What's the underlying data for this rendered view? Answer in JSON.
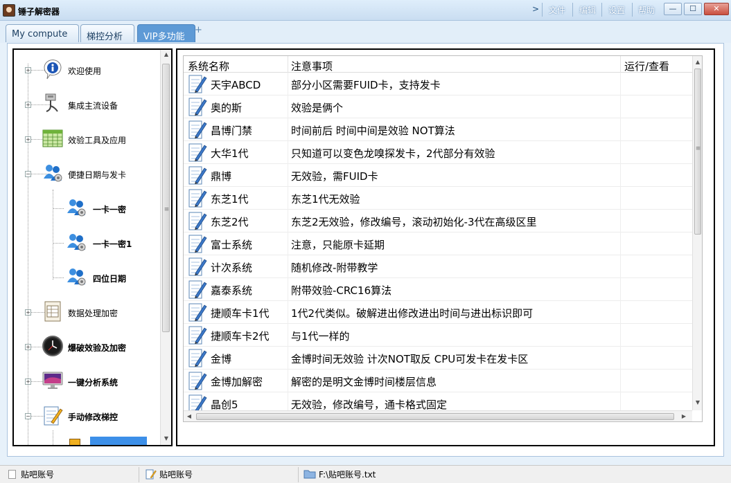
{
  "window": {
    "title": "锤子解密器",
    "menu": [
      "文件",
      "编辑",
      "设置",
      "帮助"
    ],
    "controls": {
      "minimize": "—",
      "maximize": "☐",
      "close": "✕"
    },
    "chevron": ">"
  },
  "tabs": [
    {
      "label": "My compute",
      "active": false
    },
    {
      "label": "梯控分析",
      "active": false
    },
    {
      "label": "VIP多功能",
      "active": true
    }
  ],
  "tab_add": "+",
  "tree": [
    {
      "label": "欢迎使用",
      "icon": "info-icon",
      "level": 0,
      "expander": "+",
      "bold": false
    },
    {
      "label": "集成主流设备",
      "icon": "cable-icon",
      "level": 0,
      "expander": "+",
      "bold": false
    },
    {
      "label": "效验工具及应用",
      "icon": "spreadsheet-icon",
      "level": 0,
      "expander": "+",
      "bold": false
    },
    {
      "label": "便捷日期与发卡",
      "icon": "users-gear-icon",
      "level": 0,
      "expander": "−",
      "bold": false
    },
    {
      "label": "一卡一密",
      "icon": "users-gear-icon",
      "level": 1,
      "expander": "",
      "bold": true
    },
    {
      "label": "一卡一密1",
      "icon": "users-gear-icon",
      "level": 1,
      "expander": "",
      "bold": true
    },
    {
      "label": "四位日期",
      "icon": "users-gear-icon",
      "level": 1,
      "expander": "",
      "bold": true
    },
    {
      "label": "数据处理加密",
      "icon": "document-table-icon",
      "level": 0,
      "expander": "+",
      "bold": false
    },
    {
      "label": "爆破效验及加密",
      "icon": "clock-icon",
      "level": 0,
      "expander": "+",
      "bold": true
    },
    {
      "label": "一键分析系统",
      "icon": "monitor-icon",
      "level": 0,
      "expander": "+",
      "bold": true
    },
    {
      "label": "手动修改梯控",
      "icon": "notepad-pencil-icon",
      "level": 0,
      "expander": "−",
      "bold": true
    }
  ],
  "list": {
    "columns": [
      "系统名称",
      "注意事项",
      "运行/查看"
    ],
    "rows": [
      {
        "name": "天宇ABCD",
        "note": "部分小区需要FUID卡，支持发卡"
      },
      {
        "name": "奥的斯",
        "note": "效验是俩个"
      },
      {
        "name": "昌博门禁",
        "note": "时间前后 时间中间是效验 NOT算法"
      },
      {
        "name": "大华1代",
        "note": "只知道可以变色龙嗅探发卡，2代部分有效验"
      },
      {
        "name": "鼎博",
        "note": "无效验，需FUID卡"
      },
      {
        "name": "东芝1代",
        "note": "东芝1代无效验"
      },
      {
        "name": "东芝2代",
        "note": "东芝2无效验，修改编号，滚动初始化-3代在高级区里"
      },
      {
        "name": "富士系统",
        "note": "注意，只能原卡延期"
      },
      {
        "name": "计次系统",
        "note": "随机修改-附带教学"
      },
      {
        "name": "嘉泰系统",
        "note": "附带效验-CRC16算法"
      },
      {
        "name": "捷顺车卡1代",
        "note": "1代2代类似。破解进出修改进出时间与进出标识即可"
      },
      {
        "name": "捷顺车卡2代",
        "note": "与1代一样的"
      },
      {
        "name": "金博",
        "note": "金博时间无效验 计次NOT取反 CPU可发卡在发卡区"
      },
      {
        "name": "金博加解密",
        "note": "解密的是明文金博时间楼层信息"
      },
      {
        "name": "晶创5",
        "note": "无效验，修改编号，通卡格式固定"
      }
    ]
  },
  "statusbar": {
    "panel1": "贴吧账号",
    "panel2": "贴吧账号",
    "panel3": "F:\\贴吧账号.txt"
  },
  "colors": {
    "active_tab": "#5e9ad6",
    "titlebar": "#d4e5f6",
    "selection": "#3c8fe8"
  }
}
